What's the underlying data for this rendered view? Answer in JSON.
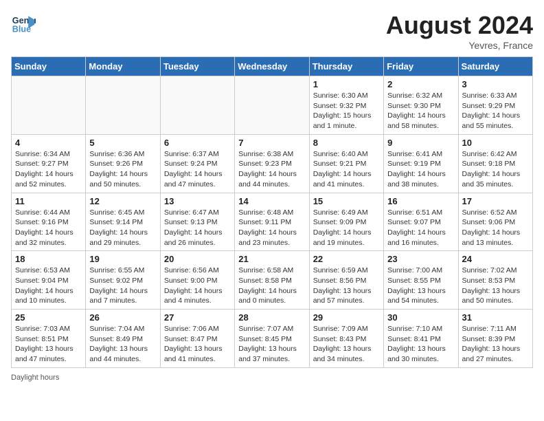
{
  "header": {
    "logo_line1": "General",
    "logo_line2": "Blue",
    "month_year": "August 2024",
    "location": "Yevres, France"
  },
  "days_of_week": [
    "Sunday",
    "Monday",
    "Tuesday",
    "Wednesday",
    "Thursday",
    "Friday",
    "Saturday"
  ],
  "weeks": [
    [
      {
        "day": "",
        "info": ""
      },
      {
        "day": "",
        "info": ""
      },
      {
        "day": "",
        "info": ""
      },
      {
        "day": "",
        "info": ""
      },
      {
        "day": "1",
        "info": "Sunrise: 6:30 AM\nSunset: 9:32 PM\nDaylight: 15 hours and 1 minute."
      },
      {
        "day": "2",
        "info": "Sunrise: 6:32 AM\nSunset: 9:30 PM\nDaylight: 14 hours and 58 minutes."
      },
      {
        "day": "3",
        "info": "Sunrise: 6:33 AM\nSunset: 9:29 PM\nDaylight: 14 hours and 55 minutes."
      }
    ],
    [
      {
        "day": "4",
        "info": "Sunrise: 6:34 AM\nSunset: 9:27 PM\nDaylight: 14 hours and 52 minutes."
      },
      {
        "day": "5",
        "info": "Sunrise: 6:36 AM\nSunset: 9:26 PM\nDaylight: 14 hours and 50 minutes."
      },
      {
        "day": "6",
        "info": "Sunrise: 6:37 AM\nSunset: 9:24 PM\nDaylight: 14 hours and 47 minutes."
      },
      {
        "day": "7",
        "info": "Sunrise: 6:38 AM\nSunset: 9:23 PM\nDaylight: 14 hours and 44 minutes."
      },
      {
        "day": "8",
        "info": "Sunrise: 6:40 AM\nSunset: 9:21 PM\nDaylight: 14 hours and 41 minutes."
      },
      {
        "day": "9",
        "info": "Sunrise: 6:41 AM\nSunset: 9:19 PM\nDaylight: 14 hours and 38 minutes."
      },
      {
        "day": "10",
        "info": "Sunrise: 6:42 AM\nSunset: 9:18 PM\nDaylight: 14 hours and 35 minutes."
      }
    ],
    [
      {
        "day": "11",
        "info": "Sunrise: 6:44 AM\nSunset: 9:16 PM\nDaylight: 14 hours and 32 minutes."
      },
      {
        "day": "12",
        "info": "Sunrise: 6:45 AM\nSunset: 9:14 PM\nDaylight: 14 hours and 29 minutes."
      },
      {
        "day": "13",
        "info": "Sunrise: 6:47 AM\nSunset: 9:13 PM\nDaylight: 14 hours and 26 minutes."
      },
      {
        "day": "14",
        "info": "Sunrise: 6:48 AM\nSunset: 9:11 PM\nDaylight: 14 hours and 23 minutes."
      },
      {
        "day": "15",
        "info": "Sunrise: 6:49 AM\nSunset: 9:09 PM\nDaylight: 14 hours and 19 minutes."
      },
      {
        "day": "16",
        "info": "Sunrise: 6:51 AM\nSunset: 9:07 PM\nDaylight: 14 hours and 16 minutes."
      },
      {
        "day": "17",
        "info": "Sunrise: 6:52 AM\nSunset: 9:06 PM\nDaylight: 14 hours and 13 minutes."
      }
    ],
    [
      {
        "day": "18",
        "info": "Sunrise: 6:53 AM\nSunset: 9:04 PM\nDaylight: 14 hours and 10 minutes."
      },
      {
        "day": "19",
        "info": "Sunrise: 6:55 AM\nSunset: 9:02 PM\nDaylight: 14 hours and 7 minutes."
      },
      {
        "day": "20",
        "info": "Sunrise: 6:56 AM\nSunset: 9:00 PM\nDaylight: 14 hours and 4 minutes."
      },
      {
        "day": "21",
        "info": "Sunrise: 6:58 AM\nSunset: 8:58 PM\nDaylight: 14 hours and 0 minutes."
      },
      {
        "day": "22",
        "info": "Sunrise: 6:59 AM\nSunset: 8:56 PM\nDaylight: 13 hours and 57 minutes."
      },
      {
        "day": "23",
        "info": "Sunrise: 7:00 AM\nSunset: 8:55 PM\nDaylight: 13 hours and 54 minutes."
      },
      {
        "day": "24",
        "info": "Sunrise: 7:02 AM\nSunset: 8:53 PM\nDaylight: 13 hours and 50 minutes."
      }
    ],
    [
      {
        "day": "25",
        "info": "Sunrise: 7:03 AM\nSunset: 8:51 PM\nDaylight: 13 hours and 47 minutes."
      },
      {
        "day": "26",
        "info": "Sunrise: 7:04 AM\nSunset: 8:49 PM\nDaylight: 13 hours and 44 minutes."
      },
      {
        "day": "27",
        "info": "Sunrise: 7:06 AM\nSunset: 8:47 PM\nDaylight: 13 hours and 41 minutes."
      },
      {
        "day": "28",
        "info": "Sunrise: 7:07 AM\nSunset: 8:45 PM\nDaylight: 13 hours and 37 minutes."
      },
      {
        "day": "29",
        "info": "Sunrise: 7:09 AM\nSunset: 8:43 PM\nDaylight: 13 hours and 34 minutes."
      },
      {
        "day": "30",
        "info": "Sunrise: 7:10 AM\nSunset: 8:41 PM\nDaylight: 13 hours and 30 minutes."
      },
      {
        "day": "31",
        "info": "Sunrise: 7:11 AM\nSunset: 8:39 PM\nDaylight: 13 hours and 27 minutes."
      }
    ]
  ],
  "footer": "Daylight hours"
}
